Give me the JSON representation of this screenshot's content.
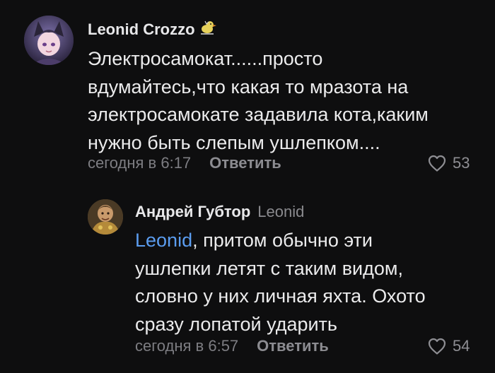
{
  "comments": [
    {
      "author": "Leonid Crozzo",
      "badge": "duck-badge-icon",
      "text_lines": [
        "Электросамокат......просто",
        "вдумайтесь,что какая то мразота на",
        "электросамокате задавила кота,каким",
        "нужно быть слепым ушлепком...."
      ],
      "time": "сегодня в 6:17",
      "reply_label": "Ответить",
      "likes": "53"
    }
  ],
  "replies": [
    {
      "author": "Андрей Губтор",
      "reply_to": "Leonid",
      "mention": "Leonid",
      "first_line_rest": ", притом обычно эти",
      "text_lines": [
        "ушлепки летят с таким видом,",
        "словно у них личная яхта. Охото",
        "сразу лопатой ударить"
      ],
      "time": "сегодня в 6:57",
      "reply_label": "Ответить",
      "likes": "54"
    }
  ],
  "icons": {
    "like": "heart-outline-icon"
  },
  "colors": {
    "background": "#0e0e0f",
    "mention": "#5b9df0",
    "meta": "#7d7d82"
  }
}
